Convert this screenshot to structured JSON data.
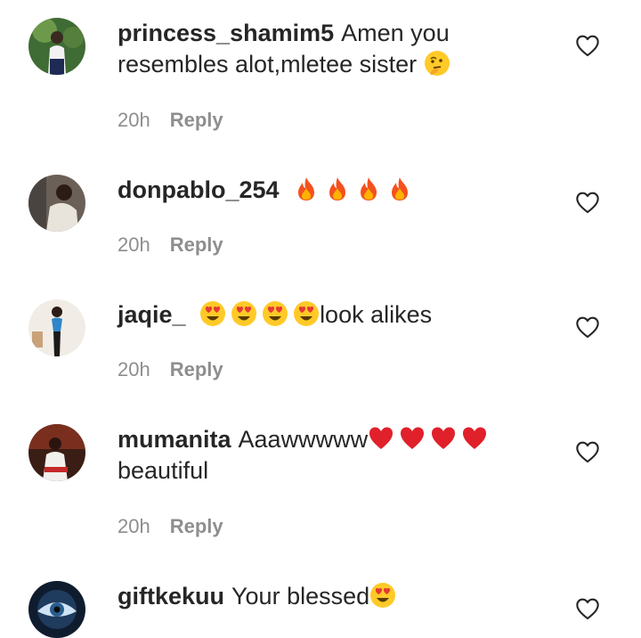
{
  "comments": [
    {
      "username": "princess_shamim5",
      "text": "Amen you resembles alot,mletee sister",
      "emojis": [
        "thinking-face"
      ],
      "time": "20h",
      "reply_label": "Reply"
    },
    {
      "username": "donpablo_254",
      "text": "",
      "emojis": [
        "fire",
        "fire",
        "fire",
        "fire"
      ],
      "time": "20h",
      "reply_label": "Reply"
    },
    {
      "username": "jaqie_",
      "text": "look alikes",
      "emojis": [
        "heart-eyes",
        "heart-eyes",
        "heart-eyes",
        "heart-eyes"
      ],
      "time": "20h",
      "reply_label": "Reply"
    },
    {
      "username": "mumanita",
      "text": "Aaawwwww",
      "text_after": "beautiful",
      "emojis": [
        "red-heart",
        "red-heart",
        "red-heart",
        "red-heart"
      ],
      "time": "20h",
      "reply_label": "Reply"
    },
    {
      "username": "giftkekuu",
      "text": "Your blessed",
      "emojis": [
        "heart-eyes"
      ],
      "time": "",
      "reply_label": ""
    }
  ],
  "colors": {
    "text": "#262626",
    "meta": "#8e8e8e"
  }
}
